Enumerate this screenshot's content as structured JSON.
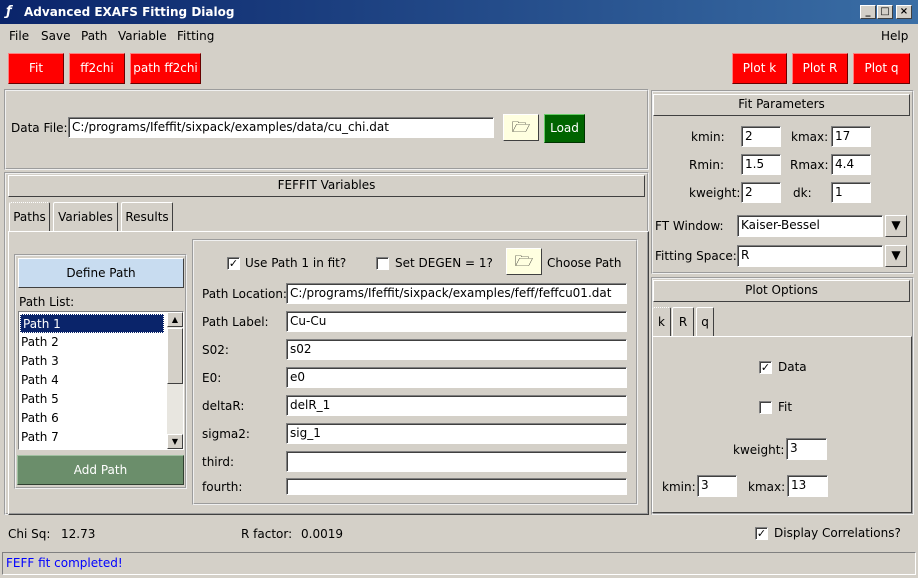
{
  "window": {
    "title": "Advanced EXAFS Fitting Dialog",
    "icon": "feather-icon"
  },
  "menu": [
    "File",
    "Save",
    "Path",
    "Variable",
    "Fitting",
    "Help"
  ],
  "toolbar": {
    "fit": "Fit",
    "ff2chi": "ff2chi",
    "path_ff2chi": "path ff2chi",
    "plot_k": "Plot k",
    "plot_r": "Plot R",
    "plot_q": "Plot q",
    "accent": "#ff0000"
  },
  "data_file": {
    "label": "Data File:",
    "value": "C:/programs/Ifeffit/sixpack/examples/data/cu_chi.dat",
    "load": "Load"
  },
  "fit_params": {
    "header": "Fit Parameters",
    "kmin_label": "kmin:",
    "kmin": "2",
    "kmax_label": "kmax:",
    "kmax": "17",
    "rmin_label": "Rmin:",
    "rmin": "1.5",
    "rmax_label": "Rmax:",
    "rmax": "4.4",
    "kweight_label": "kweight:",
    "kweight": "2",
    "dk_label": "dk:",
    "dk": "1",
    "ft_window_label": "FT Window:",
    "ft_window": "Kaiser-Bessel",
    "fitting_space_label": "Fitting Space:",
    "fitting_space": "R"
  },
  "feffit": {
    "header": "FEFFIT Variables",
    "tabs": [
      "Paths",
      "Variables",
      "Results"
    ],
    "define_path": "Define Path",
    "path_list_label": "Path List:",
    "paths": [
      "Path 1",
      "Path 2",
      "Path 3",
      "Path 4",
      "Path 5",
      "Path 6",
      "Path 7"
    ],
    "add_path": "Add Path",
    "use_path": "Use Path 1 in fit?",
    "set_degen": "Set DEGEN = 1?",
    "choose_path": "Choose Path",
    "fields": {
      "location_label": "Path Location:",
      "location": "C:/programs/Ifeffit/sixpack/examples/feff/feffcu01.dat",
      "label_label": "Path Label:",
      "label": "Cu-Cu",
      "s02_label": "S02:",
      "s02": "s02",
      "e0_label": "E0:",
      "e0": "e0",
      "deltar_label": "deltaR:",
      "deltar": "delR_1",
      "sigma2_label": "sigma2:",
      "sigma2": "sig_1",
      "third_label": "third:",
      "third": "",
      "fourth_label": "fourth:",
      "fourth": ""
    }
  },
  "plot_options": {
    "header": "Plot Options",
    "tabs": [
      "k",
      "R",
      "q"
    ],
    "data": "Data",
    "fit": "Fit",
    "kweight_label": "kweight:",
    "kweight": "3",
    "kmin_label": "kmin:",
    "kmin": "3",
    "kmax_label": "kmax:",
    "kmax": "13"
  },
  "results": {
    "chisq_label": "Chi Sq:",
    "chisq": "12.73",
    "rfactor_label": "R factor:",
    "rfactor": "0.0019",
    "correlations": "Display Correlations?"
  },
  "status": "FEFF fit completed!"
}
